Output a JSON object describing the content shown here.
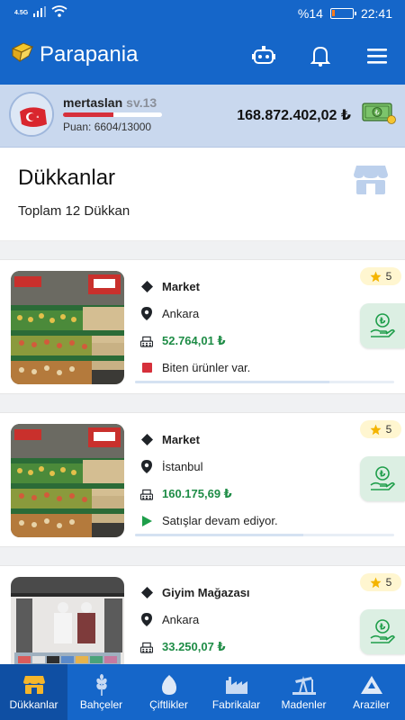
{
  "status_bar": {
    "network": "4.5G",
    "battery_text": "%14",
    "time": "22:41"
  },
  "app": {
    "title": "Parapania"
  },
  "profile": {
    "username": "mertaslan",
    "level": "sv.13",
    "score_label": "Puan: 6604/13000",
    "xp_fraction": 0.508,
    "balance": "168.872.402,02 ₺"
  },
  "page": {
    "title": "Dükkanlar",
    "subtitle": "Toplam 12 Dükkan"
  },
  "shops": [
    {
      "type": "Market",
      "city": "Ankara",
      "revenue": "52.764,01 ₺",
      "status": "Biten ürünler var.",
      "status_kind": "warning",
      "stars": "5",
      "progress": 0.75
    },
    {
      "type": "Market",
      "city": "İstanbul",
      "revenue": "160.175,69 ₺",
      "status": "Satışlar devam ediyor.",
      "status_kind": "running",
      "stars": "5",
      "progress": 0.65
    },
    {
      "type": "Giyim Mağazası",
      "city": "Ankara",
      "revenue": "33.250,07 ₺",
      "status": "",
      "status_kind": "",
      "stars": "5",
      "progress": 0.5
    }
  ],
  "nav": [
    {
      "label": "Dükkanlar",
      "icon": "shop-icon",
      "active": true
    },
    {
      "label": "Bahçeler",
      "icon": "wheat-icon",
      "active": false
    },
    {
      "label": "Çiftlikler",
      "icon": "egg-icon",
      "active": false
    },
    {
      "label": "Fabrikalar",
      "icon": "factory-icon",
      "active": false
    },
    {
      "label": "Madenler",
      "icon": "oil-pump-icon",
      "active": false
    },
    {
      "label": "Araziler",
      "icon": "land-icon",
      "active": false
    }
  ],
  "colors": {
    "primary": "#1566c9",
    "profile_bg": "#c9d8ee",
    "money_green": "#1e8c46",
    "warning_red": "#d6303b",
    "running_green": "#1e9e4a"
  }
}
